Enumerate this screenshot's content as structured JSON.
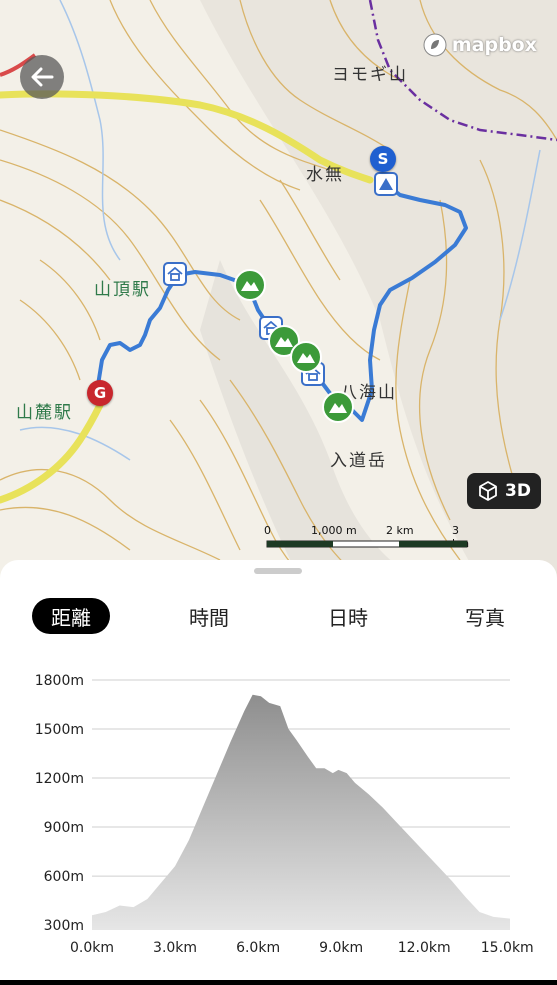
{
  "map": {
    "labels": {
      "yomogi": "ヨモギ山",
      "suimu": "水無",
      "sancho_eki": "山頂駅",
      "sanroku_eki": "山麓駅",
      "hakkai": "八海山",
      "nyudo": "入道岳"
    },
    "route_color": "#3a7bd5",
    "start_pin": "S",
    "goal_pin": "G",
    "start_color": "#1f5fd0",
    "goal_color": "#c8272d",
    "peak_color": "#3c9a3a",
    "road_color": "#e8e25a",
    "contour_color": "#d9b46a",
    "mapbox_text": "mapbox",
    "btn_3d": "3D",
    "scale_labels": [
      "0",
      "1,000 m",
      "2 km",
      "3 km"
    ],
    "icons": {
      "back": "arrow-left-icon",
      "cube": "cube-icon",
      "hut": "hut-icon",
      "peak": "mountain-icon",
      "tent": "tent-icon"
    }
  },
  "tabs": [
    {
      "label": "距離",
      "active": true
    },
    {
      "label": "時間",
      "active": false
    },
    {
      "label": "日時",
      "active": false
    },
    {
      "label": "写真",
      "active": false
    }
  ],
  "chart_data": {
    "type": "area",
    "x_unit": "km",
    "y_unit": "m",
    "x_ticks": [
      "0.0km",
      "3.0km",
      "6.0km",
      "9.0km",
      "12.0km",
      "15.0km"
    ],
    "y_ticks": [
      "300m",
      "600m",
      "900m",
      "1200m",
      "1500m",
      "1800m"
    ],
    "xlim": [
      0,
      15.1
    ],
    "ylim": [
      270,
      1800
    ],
    "x": [
      0,
      0.5,
      1.0,
      1.5,
      2.0,
      2.5,
      3.0,
      3.5,
      4.0,
      4.5,
      5.0,
      5.5,
      5.8,
      6.1,
      6.4,
      6.8,
      7.1,
      7.4,
      7.8,
      8.1,
      8.4,
      8.7,
      8.9,
      9.2,
      9.5,
      10.0,
      10.5,
      11.0,
      11.5,
      12.0,
      12.5,
      13.0,
      13.5,
      14.0,
      14.5,
      15.1
    ],
    "y": [
      360,
      380,
      420,
      410,
      460,
      560,
      660,
      820,
      1020,
      1220,
      1420,
      1610,
      1710,
      1700,
      1660,
      1640,
      1500,
      1430,
      1330,
      1260,
      1260,
      1230,
      1250,
      1230,
      1170,
      1100,
      1020,
      930,
      840,
      750,
      660,
      570,
      470,
      380,
      350,
      340
    ],
    "grid": true
  }
}
